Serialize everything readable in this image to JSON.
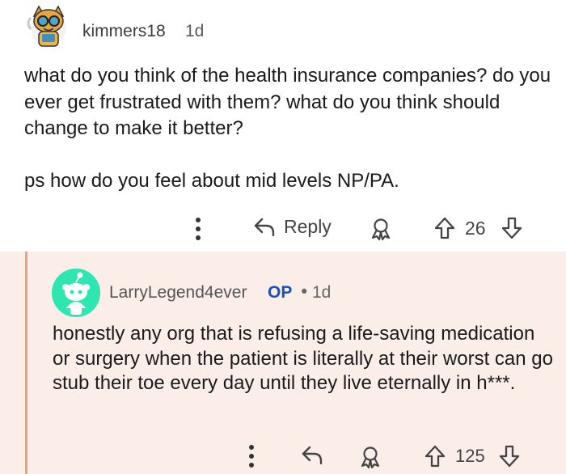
{
  "comment": {
    "username": "kimmers18",
    "age": "1d",
    "body_lines": [
      "what do you think of the health insurance companies? do you ever get frustrated with them? what do you think should change to make it better?",
      "ps how do you feel about mid levels NP/PA."
    ],
    "actions": {
      "more_icon": "more-vertical-icon",
      "reply_label": "Reply",
      "reply_icon": "reply-arrow-icon",
      "award_icon": "award-icon",
      "vote_count": "26"
    }
  },
  "reply": {
    "username": "LarryLegend4ever",
    "op_badge": "OP",
    "separator": "•",
    "age": "1d",
    "body": "honestly any org that is refusing a life-saving medication or surgery when the patient is literally at their worst can go stub their toe every day until they live eternally in h***.",
    "actions": {
      "more_icon": "more-vertical-icon",
      "reply_icon": "reply-arrow-icon",
      "award_icon": "award-icon",
      "vote_count": "125"
    }
  },
  "colors": {
    "reply_bg": "#fbeee9",
    "thread_line": "#f5a07d",
    "op_blue": "#1a4fc4",
    "avatar2_bg": "#2ee6b0"
  }
}
